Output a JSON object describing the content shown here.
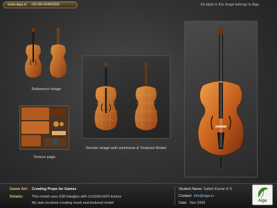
{
  "header": {
    "website": "www.aiga.in",
    "phone": "+91-80-40400500",
    "rights": "All rights to this image belongs to Aiga"
  },
  "panels": {
    "reference_caption": "Reference Image",
    "texture_caption": "Texture page",
    "render_caption": "Render image with wireframe & Textured Model"
  },
  "info": {
    "game_art_label": "Game Art:",
    "game_art_value": "Creating Props for Games",
    "details_label": "Details:",
    "details_line1": "This model uses 638 triangles with 1x1024x1024 texture",
    "details_line2": "My task involved creating mesh and textured model",
    "student_label": "Student Name:",
    "student_value": "Satish Kumar K S",
    "contact_label": "Contact:",
    "contact_value": "info@aiga.in",
    "date_label": "Date:",
    "date_value": "Nov 2009",
    "logo_text": "Aiga"
  },
  "colors": {
    "wood": "#b8561a",
    "wood_light": "#e08a3a",
    "label_gold": "#e8c36a"
  }
}
